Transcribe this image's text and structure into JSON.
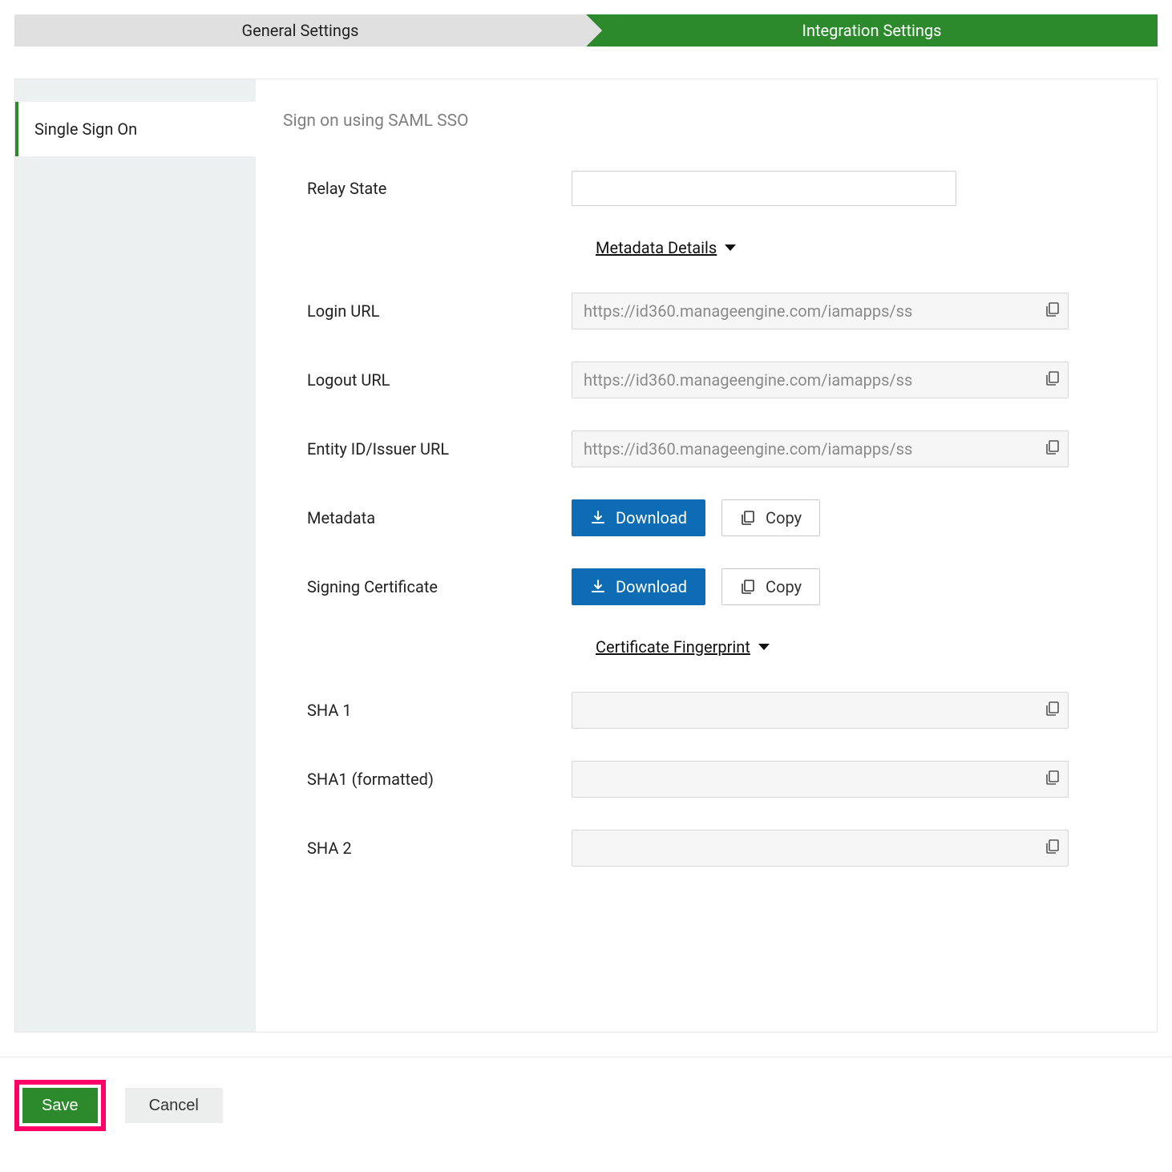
{
  "tabs": {
    "general": "General Settings",
    "integration": "Integration Settings"
  },
  "sidebar": {
    "sso": "Single Sign On"
  },
  "section": {
    "title": "Sign on using SAML SSO"
  },
  "fields": {
    "relay_state_label": "Relay State",
    "relay_state_value": "",
    "metadata_details_label": "Metadata Details",
    "login_url_label": "Login URL",
    "login_url_value": "https://id360.manageengine.com/iamapps/ss",
    "logout_url_label": "Logout URL",
    "logout_url_value": "https://id360.manageengine.com/iamapps/ss",
    "entity_id_label": "Entity ID/Issuer URL",
    "entity_id_value": "https://id360.manageengine.com/iamapps/ss",
    "metadata_label": "Metadata",
    "signing_cert_label": "Signing Certificate",
    "cert_fingerprint_label": "Certificate Fingerprint",
    "sha1_label": "SHA 1",
    "sha1_value": "",
    "sha1_formatted_label": "SHA1 (formatted)",
    "sha1_formatted_value": "",
    "sha2_label": "SHA 2",
    "sha2_value": ""
  },
  "buttons": {
    "download": "Download",
    "copy": "Copy",
    "save": "Save",
    "cancel": "Cancel"
  }
}
